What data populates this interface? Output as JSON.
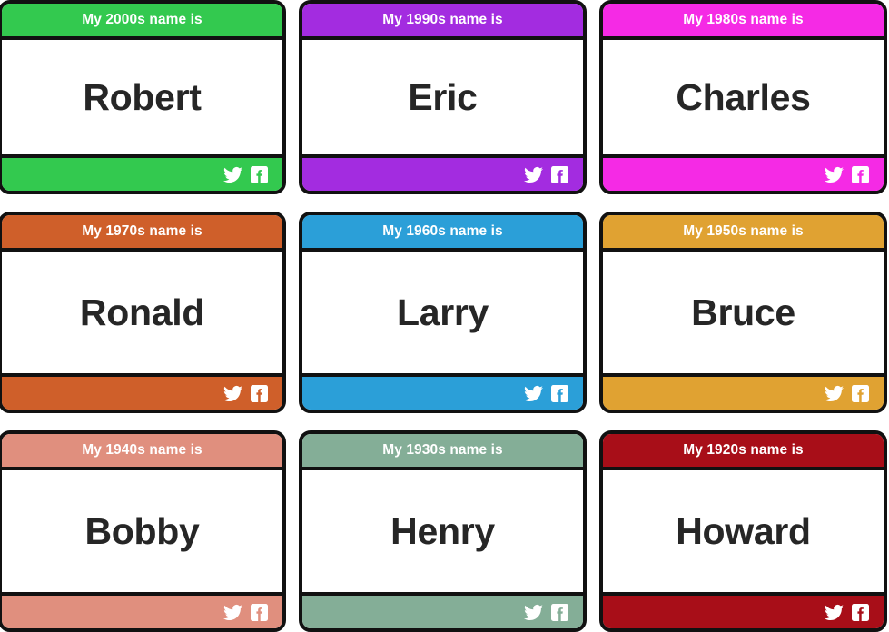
{
  "page": {
    "background_color": "#ffffff",
    "border_color": "#111111",
    "name_text_color": "#262626",
    "header_text_color": "#ffffff"
  },
  "social": {
    "twitter_label": "Twitter",
    "twitter_icon": "twitter-bird-icon",
    "facebook_label": "Facebook",
    "facebook_icon": "facebook-f-icon"
  },
  "cards": [
    {
      "id": "card-2000s",
      "decade": "2000s",
      "header": "My 2000s name is",
      "name": "Robert",
      "color": "#33c94f"
    },
    {
      "id": "card-1990s",
      "decade": "1990s",
      "header": "My 1990s name is",
      "name": "Eric",
      "color": "#a32ce0"
    },
    {
      "id": "card-1980s",
      "decade": "1980s",
      "header": "My 1980s name is",
      "name": "Charles",
      "color": "#f52ae5"
    },
    {
      "id": "card-1970s",
      "decade": "1970s",
      "header": "My 1970s name is",
      "name": "Ronald",
      "color": "#cf5f2a"
    },
    {
      "id": "card-1960s",
      "decade": "1960s",
      "header": "My 1960s name is",
      "name": "Larry",
      "color": "#2b9fd8"
    },
    {
      "id": "card-1950s",
      "decade": "1950s",
      "header": "My 1950s name is",
      "name": "Bruce",
      "color": "#e0a232"
    },
    {
      "id": "card-1940s",
      "decade": "1940s",
      "header": "My 1940s name is",
      "name": "Bobby",
      "color": "#e08f7e"
    },
    {
      "id": "card-1930s",
      "decade": "1930s",
      "header": "My 1930s name is",
      "name": "Henry",
      "color": "#84ae97"
    },
    {
      "id": "card-1920s",
      "decade": "1920s",
      "header": "My 1920s name is",
      "name": "Howard",
      "color": "#a80e18"
    }
  ]
}
